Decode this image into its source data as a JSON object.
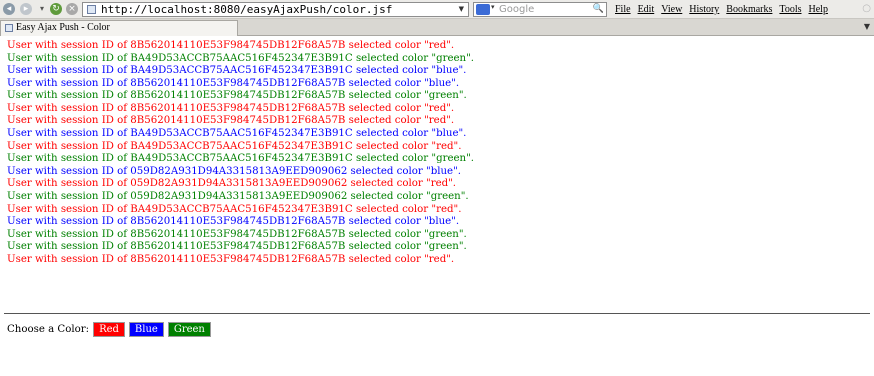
{
  "browser": {
    "url": "http://localhost:8080/easyAjaxPush/color.jsf",
    "search_placeholder": "Google",
    "menu": [
      "File",
      "Edit",
      "View",
      "History",
      "Bookmarks",
      "Tools",
      "Help"
    ],
    "tab_title": "Easy Ajax Push - Color"
  },
  "colors": {
    "red": "#ff0000",
    "green": "#008000",
    "blue": "#0000ff"
  },
  "log": [
    {
      "text": "User with session ID of 8B562014110E53F984745DB12F68A57B selected color \"red\".",
      "color": "red"
    },
    {
      "text": "User with session ID of BA49D53ACCB75AAC516F452347E3B91C selected color \"green\".",
      "color": "green"
    },
    {
      "text": "User with session ID of BA49D53ACCB75AAC516F452347E3B91C selected color \"blue\".",
      "color": "blue"
    },
    {
      "text": "User with session ID of 8B562014110E53F984745DB12F68A57B selected color \"blue\".",
      "color": "blue"
    },
    {
      "text": "User with session ID of 8B562014110E53F984745DB12F68A57B selected color \"green\".",
      "color": "green"
    },
    {
      "text": "User with session ID of 8B562014110E53F984745DB12F68A57B selected color \"red\".",
      "color": "red"
    },
    {
      "text": "User with session ID of 8B562014110E53F984745DB12F68A57B selected color \"red\".",
      "color": "red"
    },
    {
      "text": "User with session ID of BA49D53ACCB75AAC516F452347E3B91C selected color \"blue\".",
      "color": "blue"
    },
    {
      "text": "User with session ID of BA49D53ACCB75AAC516F452347E3B91C selected color \"red\".",
      "color": "red"
    },
    {
      "text": "User with session ID of BA49D53ACCB75AAC516F452347E3B91C selected color \"green\".",
      "color": "green"
    },
    {
      "text": "User with session ID of 059D82A931D94A3315813A9EED909062 selected color \"blue\".",
      "color": "blue"
    },
    {
      "text": "User with session ID of 059D82A931D94A3315813A9EED909062 selected color \"red\".",
      "color": "red"
    },
    {
      "text": "User with session ID of 059D82A931D94A3315813A9EED909062 selected color \"green\".",
      "color": "green"
    },
    {
      "text": "User with session ID of BA49D53ACCB75AAC516F452347E3B91C selected color \"red\".",
      "color": "red"
    },
    {
      "text": "User with session ID of 8B562014110E53F984745DB12F68A57B selected color \"blue\".",
      "color": "blue"
    },
    {
      "text": "User with session ID of 8B562014110E53F984745DB12F68A57B selected color \"green\".",
      "color": "green"
    },
    {
      "text": "User with session ID of 8B562014110E53F984745DB12F68A57B selected color \"green\".",
      "color": "green"
    },
    {
      "text": "User with session ID of 8B562014110E53F984745DB12F68A57B selected color \"red\".",
      "color": "red"
    }
  ],
  "chooser": {
    "label": "Choose a Color:",
    "buttons": [
      {
        "label": "Red",
        "color": "red"
      },
      {
        "label": "Blue",
        "color": "blue"
      },
      {
        "label": "Green",
        "color": "green"
      }
    ]
  }
}
